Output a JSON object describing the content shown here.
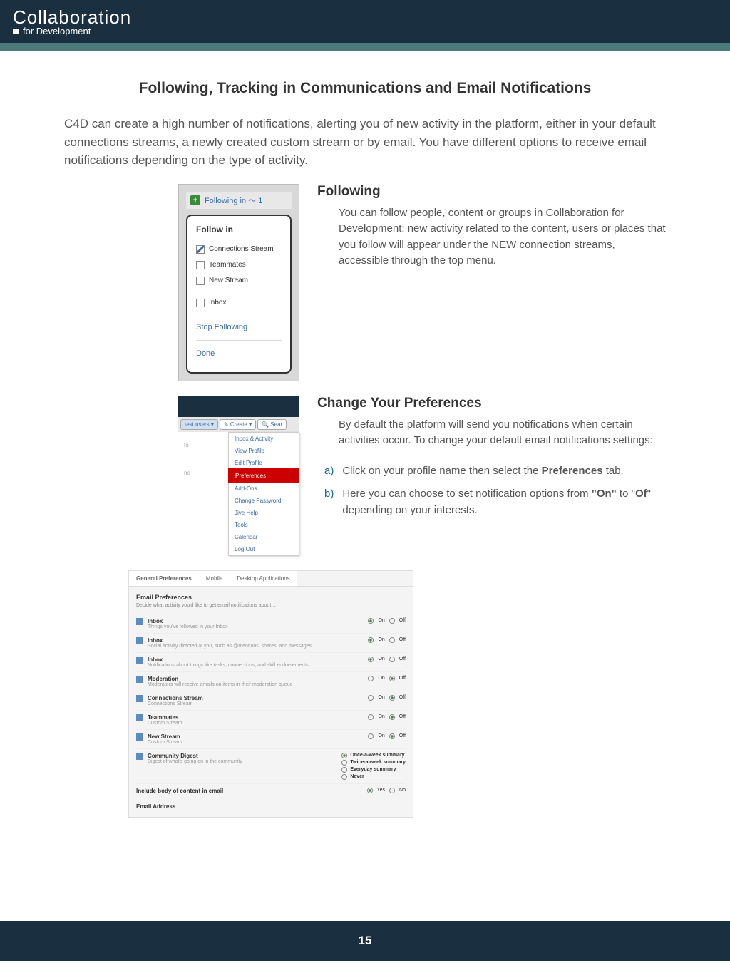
{
  "header": {
    "brand": "Collaboration",
    "tagline_prefix": "■■■",
    "tagline": "for Development"
  },
  "title": "Following, Tracking in Communications and Email Notifications",
  "intro": "C4D can create a high number of notifications, alerting  you of new activity in the platform, either in your default connections streams, a newly created custom stream or by email. You have different options to receive email notifications depending on the type of activity.",
  "sections": {
    "following": {
      "heading": "Following",
      "body": "You can follow people, content or groups in Collaboration for Development: new activity related to the content, users or places that you follow will appear under the NEW connection streams, accessible through the top menu."
    },
    "change": {
      "heading": "Change Your Preferences",
      "body": "By default the platform will send you notifications when certain activities occur. To change your default email notifications settings:",
      "steps": [
        {
          "letter": "a)",
          "text_pre": "Click on your profile name then select  the ",
          "bold": "Preferences",
          "text_post": " tab."
        },
        {
          "letter": "b)",
          "text_pre": "Here you can choose to set  notification options from ",
          "bold": "\"On\"",
          "text_mid": " to \"",
          "bold2": "Of",
          "text_post": "\" depending on your interests."
        }
      ]
    }
  },
  "popup1": {
    "head": "Following in  ～  1",
    "title": "Follow in",
    "items": [
      {
        "label": "Connections Stream",
        "checked": true
      },
      {
        "label": "Teammates",
        "checked": false
      },
      {
        "label": "New Stream",
        "checked": false
      },
      {
        "label": "Inbox",
        "checked": false
      }
    ],
    "stop": "Stop Following",
    "done": "Done"
  },
  "popup2": {
    "user_pill": "test users ▾",
    "create_pill": "✎ Create ▾",
    "search": "🔍 Sear",
    "area_labels": [
      "to",
      "no"
    ],
    "menu": [
      "Inbox & Activity",
      "View Profile",
      "Edit Profile",
      "Preferences",
      "Add-Ons",
      "Change Password",
      "Jive Help",
      "Tools",
      "Calendar",
      "Log Out"
    ],
    "highlight_index": 3
  },
  "prefs": {
    "tabs": [
      "General Preferences",
      "Mobile",
      "Desktop Applications"
    ],
    "heading": "Email Preferences",
    "sub": "Decide what activity you'd like to get email notifications about…",
    "rows": [
      {
        "name": "Inbox",
        "desc": "Things you've followed in your Inbox",
        "on": true
      },
      {
        "name": "Inbox",
        "desc": "Social activity directed at you, such as @mentions, shares, and messages",
        "on": true
      },
      {
        "name": "Inbox",
        "desc": "Notifications about things like tasks, connections, and skill endorsements",
        "on": true
      },
      {
        "name": "Moderation",
        "desc": "Moderators will receive emails on items in their moderation queue",
        "on": false
      },
      {
        "name": "Connections Stream",
        "desc": "Connections Stream",
        "on": false
      },
      {
        "name": "Teammates",
        "desc": "Custom Stream",
        "on": false
      },
      {
        "name": "New Stream",
        "desc": "Custom Stream",
        "on": false
      }
    ],
    "digest": {
      "name": "Community Digest",
      "desc": "Digest of what's going on in the community",
      "opts": [
        "Once-a-week summary",
        "Twice-a-week summary",
        "Everyday summary",
        "Never"
      ],
      "selected": 0
    },
    "include_label": "Include body of content in email",
    "include_yes": "Yes",
    "include_no": "No",
    "addr": "Email Address",
    "on": "On",
    "off": "Off"
  },
  "page_number": "15"
}
